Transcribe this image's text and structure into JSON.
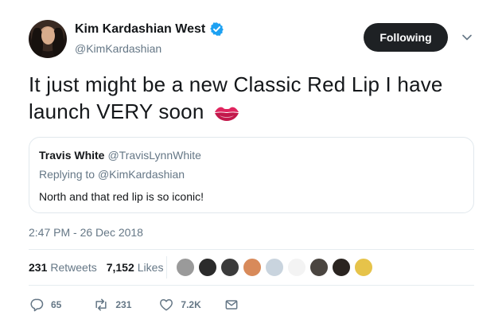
{
  "author": {
    "display_name": "Kim Kardashian West",
    "handle": "@KimKardashian",
    "verified": true
  },
  "follow_button": {
    "label": "Following"
  },
  "tweet": {
    "text": "It just might be a new Classic Red Lip I have launch VERY soon",
    "emoji": "kiss-mark-icon"
  },
  "quoted_tweet": {
    "name": "Travis White",
    "handle": "@TravisLynnWhite",
    "replying_prefix": "Replying to",
    "replying_to": "@KimKardashian",
    "text": "North and that red lip is so iconic!"
  },
  "timestamp": "2:47 PM - 26 Dec 2018",
  "stats": {
    "retweets_count": "231",
    "retweets_label": "Retweets",
    "likes_count": "7,152",
    "likes_label": "Likes"
  },
  "likers": [
    {
      "name": "liker-avatar",
      "color": "#9a9a9a"
    },
    {
      "name": "liker-avatar",
      "color": "#2b2b2b"
    },
    {
      "name": "liker-avatar",
      "color": "#3b3b3b"
    },
    {
      "name": "liker-avatar",
      "color": "#d88a5a"
    },
    {
      "name": "liker-avatar",
      "color": "#c9d4de"
    },
    {
      "name": "liker-avatar",
      "color": "#f3f3f3"
    },
    {
      "name": "liker-avatar",
      "color": "#4a4540"
    },
    {
      "name": "liker-avatar",
      "color": "#2a2420"
    },
    {
      "name": "liker-avatar",
      "color": "#e6c34a"
    }
  ],
  "actions": {
    "reply_count": "65",
    "retweet_count": "231",
    "like_count": "7.2K"
  },
  "colors": {
    "text_primary": "#14171a",
    "text_secondary": "#657786",
    "verified_blue": "#1da1f2",
    "follow_bg": "#1e2124",
    "kiss_red": "#e0245e"
  }
}
